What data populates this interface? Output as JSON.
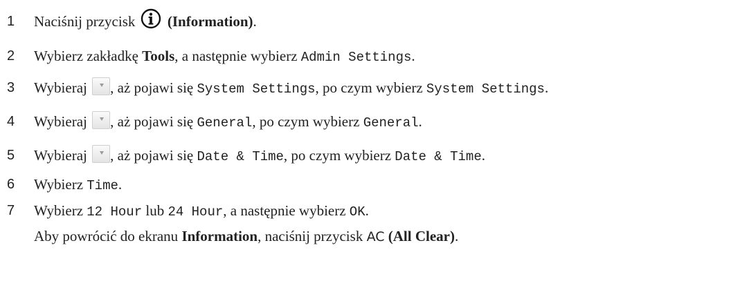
{
  "steps": [
    {
      "number": "1",
      "parts": [
        "Naciśnij przycisk",
        "(Information)",
        "."
      ]
    },
    {
      "number": "2",
      "parts": [
        "Wybierz zakładkę",
        "Tools",
        ", a następnie wybierz",
        "Admin Settings",
        "."
      ]
    },
    {
      "number": "3",
      "parts": [
        "Wybieraj",
        ", aż pojawi się",
        "System Settings",
        ", po czym wybierz",
        "System Settings",
        "."
      ]
    },
    {
      "number": "4",
      "parts": [
        "Wybieraj",
        ", aż pojawi się",
        "General",
        ", po czym wybierz",
        "General",
        "."
      ]
    },
    {
      "number": "5",
      "parts": [
        "Wybieraj",
        ", aż pojawi się",
        "Date & Time",
        ", po czym wybierz",
        "Date & Time",
        "."
      ]
    },
    {
      "number": "6",
      "parts": [
        "Wybierz",
        "Time",
        "."
      ]
    },
    {
      "number": "7",
      "parts": [
        "Wybierz",
        "12 Hour",
        "lub",
        "24 Hour",
        ", a następnie wybierz",
        "OK",
        "."
      ]
    }
  ],
  "footer": {
    "parts": [
      "Aby powrócić do ekranu",
      "Information",
      ", naciśnij przycisk",
      "AC",
      "(All Clear)",
      "."
    ]
  },
  "icons": {
    "info": "information-circle-icon",
    "scroll_down": "scroll-down-arrow-icon"
  }
}
